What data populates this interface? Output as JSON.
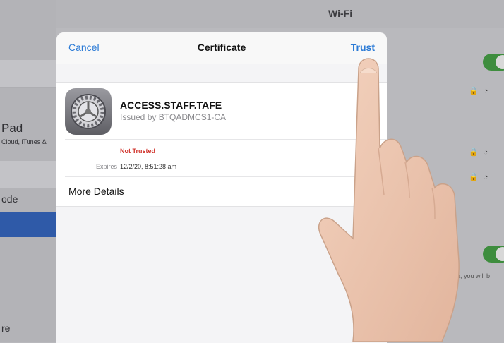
{
  "background": {
    "header_title": "Wi-Fi",
    "sidebar_items": [
      "Pad",
      "Cloud, iTunes &",
      "ode",
      "re"
    ],
    "detail_note": "ble, you will b"
  },
  "sheet": {
    "cancel_label": "Cancel",
    "title": "Certificate",
    "trust_label": "Trust",
    "icon": "settings-gear-icon",
    "cert_name": "ACCESS.STAFF.TAFE",
    "issuer": "Issued by BTQADMCS1-CA",
    "status": "Not Trusted",
    "expires_label": "Expires",
    "expires_value": "12/2/20, 8:51:28 am",
    "more_details_label": "More Details"
  },
  "colors": {
    "accent": "#2a7ad6",
    "warning": "#d0342c",
    "toggle_on": "#3e8d3e"
  }
}
